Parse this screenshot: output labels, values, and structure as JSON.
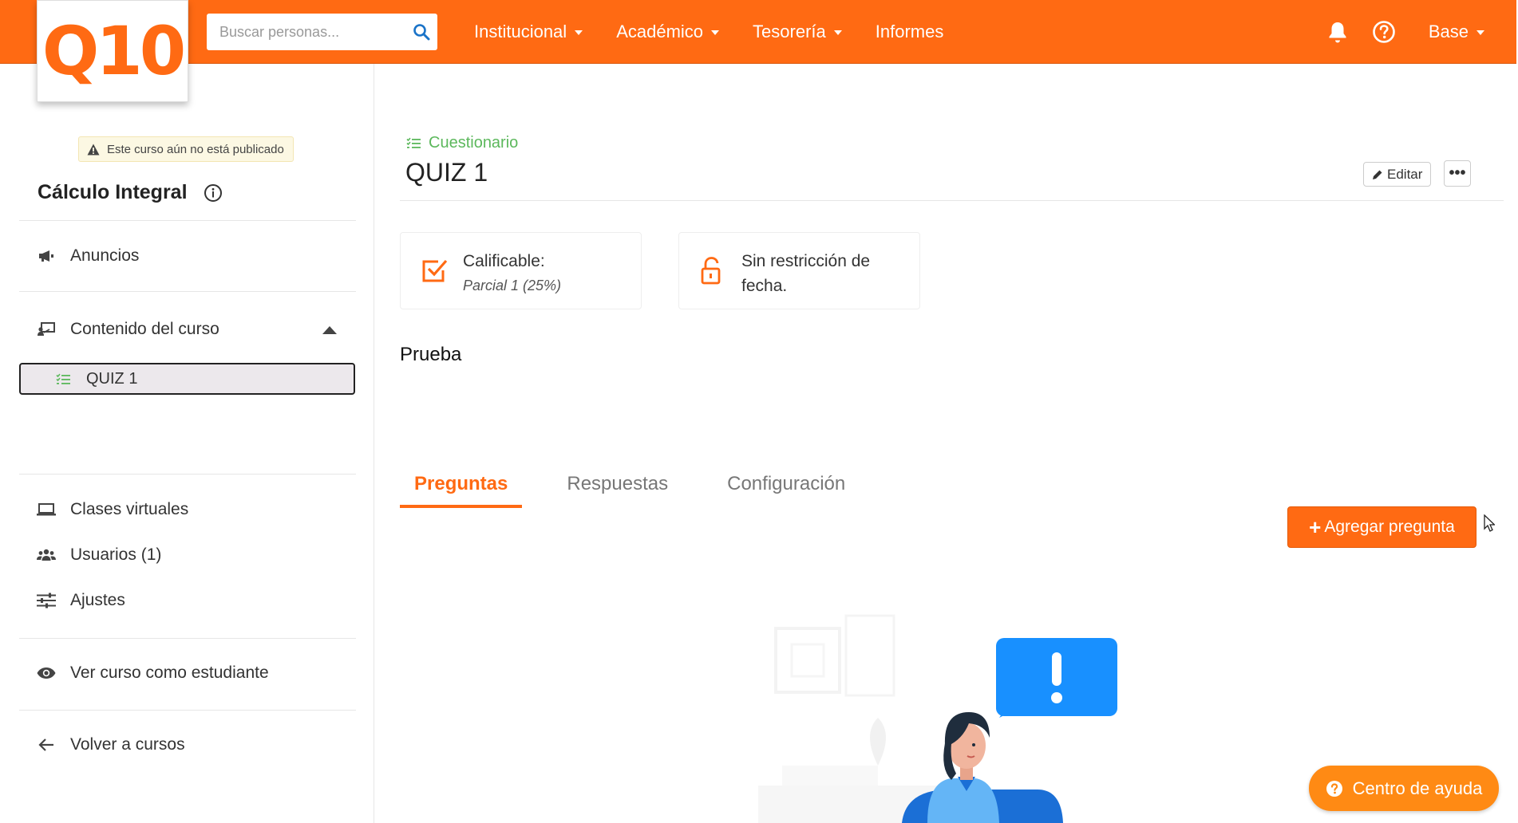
{
  "brand": {
    "logo_text": "Q10",
    "accent": "#ff6a13"
  },
  "header": {
    "search_placeholder": "Buscar personas...",
    "nav": [
      {
        "label": "Institucional",
        "has_dropdown": true
      },
      {
        "label": "Académico",
        "has_dropdown": true
      },
      {
        "label": "Tesorería",
        "has_dropdown": true
      },
      {
        "label": "Informes",
        "has_dropdown": false
      }
    ],
    "user_menu": "Base",
    "icons": [
      "bell-icon",
      "help-circle-icon"
    ]
  },
  "sidebar": {
    "unpublished_notice": "Este curso aún no está publicado",
    "course_title": "Cálculo Integral",
    "items": {
      "announcements": "Anuncios",
      "content": "Contenido del curso",
      "content_child": "QUIZ 1",
      "virtual_classes": "Clases virtuales",
      "users": "Usuarios (1)",
      "settings": "Ajustes",
      "view_as_student": "Ver curso como estudiante",
      "back": "Volver a cursos"
    }
  },
  "main": {
    "type_label": "Cuestionario",
    "title": "QUIZ 1",
    "edit_label": "Editar",
    "more_label": "•••",
    "cards": {
      "gradable_label": "Calificable:",
      "gradable_value": "Parcial 1 (25%)",
      "restriction_line1": "Sin restricción de",
      "restriction_line2": "fecha."
    },
    "section_label": "Prueba",
    "tabs": [
      {
        "label": "Preguntas",
        "active": true
      },
      {
        "label": "Respuestas",
        "active": false
      },
      {
        "label": "Configuración",
        "active": false
      }
    ],
    "add_question_label": "Agregar pregunta"
  },
  "help": {
    "label": "Centro de ayuda"
  }
}
